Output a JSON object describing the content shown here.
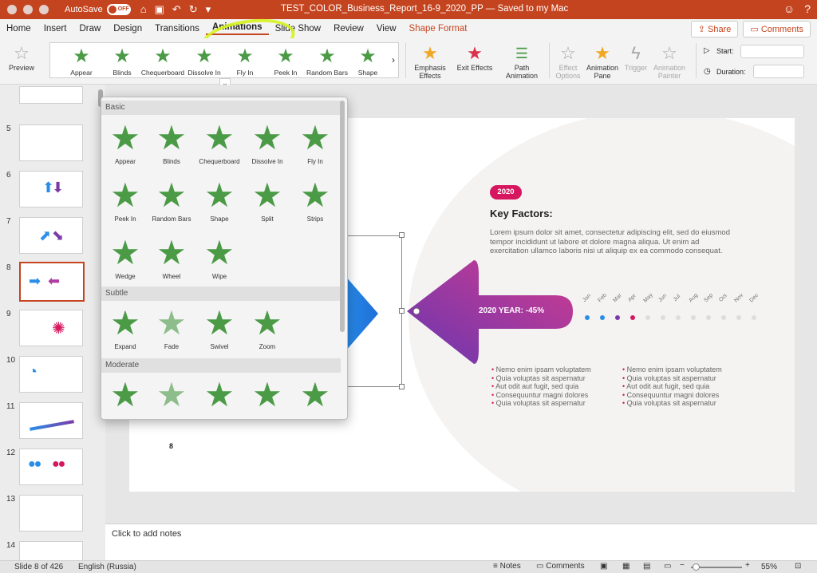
{
  "titlebar": {
    "autosave_label": "AutoSave",
    "autosave_state": "OFF",
    "document_title": "TEST_COLOR_Business_Report_16-9_2020_PP — Saved to my Mac"
  },
  "tabs": [
    "Home",
    "Insert",
    "Draw",
    "Design",
    "Transitions",
    "Animations",
    "Slide Show",
    "Review",
    "View",
    "Shape Format"
  ],
  "share_label": "Share",
  "comments_label": "Comments",
  "ribbon": {
    "preview": "Preview",
    "gallery": [
      "Appear",
      "Blinds",
      "Chequerboard",
      "Dissolve In",
      "Fly In",
      "Peek In",
      "Random Bars",
      "Shape"
    ],
    "emphasis": "Emphasis Effects",
    "exit": "Exit Effects",
    "path": "Path Animation",
    "effect_options": "Effect Options",
    "animation_pane": "Animation Pane",
    "trigger": "Trigger",
    "animation_painter": "Animation Painter",
    "start_label": "Start:",
    "duration_label": "Duration:"
  },
  "thumbnails": [
    "5",
    "6",
    "7",
    "8",
    "9",
    "10",
    "11",
    "12",
    "13",
    "14"
  ],
  "dropdown": {
    "sections": [
      "Basic",
      "Subtle",
      "Moderate"
    ],
    "basic": [
      "Appear",
      "Blinds",
      "Chequerboard",
      "Dissolve In",
      "Fly In",
      "Peek In",
      "Random Bars",
      "Shape",
      "Split",
      "Strips",
      "Wedge",
      "Wheel",
      "Wipe"
    ],
    "subtle": [
      "Expand",
      "Fade",
      "Swivel",
      "Zoom"
    ]
  },
  "slide": {
    "badge": "2020",
    "heading": "Key Factors:",
    "body": "Lorem ipsum dolor sit amet, consectetur adipiscing elit, sed do eiusmod tempor incididunt ut labore et dolore magna aliqua. Ut enim ad exercitation ullamco laboris nisi ut aliquip ex ea commodo consequat.",
    "arrow_label": "2020 YEAR: -45%",
    "months": [
      "Jan",
      "Feb",
      "Mar",
      "Apr",
      "May",
      "Jun",
      "Jul",
      "Aug",
      "Sep",
      "Oct",
      "Nov",
      "Dec"
    ],
    "bullets_left": [
      "Nemo enim ipsam voluptatem",
      "Quia voluptas sit aspernatur",
      "Aut odit aut fugit, sed quia",
      "Consequuntur magni dolores",
      "Quia voluptas sit aspernatur"
    ],
    "bullets_right": [
      "Nemo enim ipsam voluptatem",
      "Quia voluptas sit aspernatur",
      "Aut odit aut fugit, sed quia",
      "Consequuntur magni dolores",
      "Quia voluptas sit aspernatur"
    ],
    "page_number": "8",
    "colors": {
      "brand": "#c4441f",
      "badge": "#d6175f",
      "purple": "#7b3aa8",
      "blue": "#2a8ee8",
      "green": "#4a9a46"
    }
  },
  "notes_placeholder": "Click to add notes",
  "status": {
    "slide": "Slide 8 of 426",
    "language": "English (Russia)",
    "notes": "Notes",
    "comments": "Comments",
    "zoom": "55%"
  }
}
